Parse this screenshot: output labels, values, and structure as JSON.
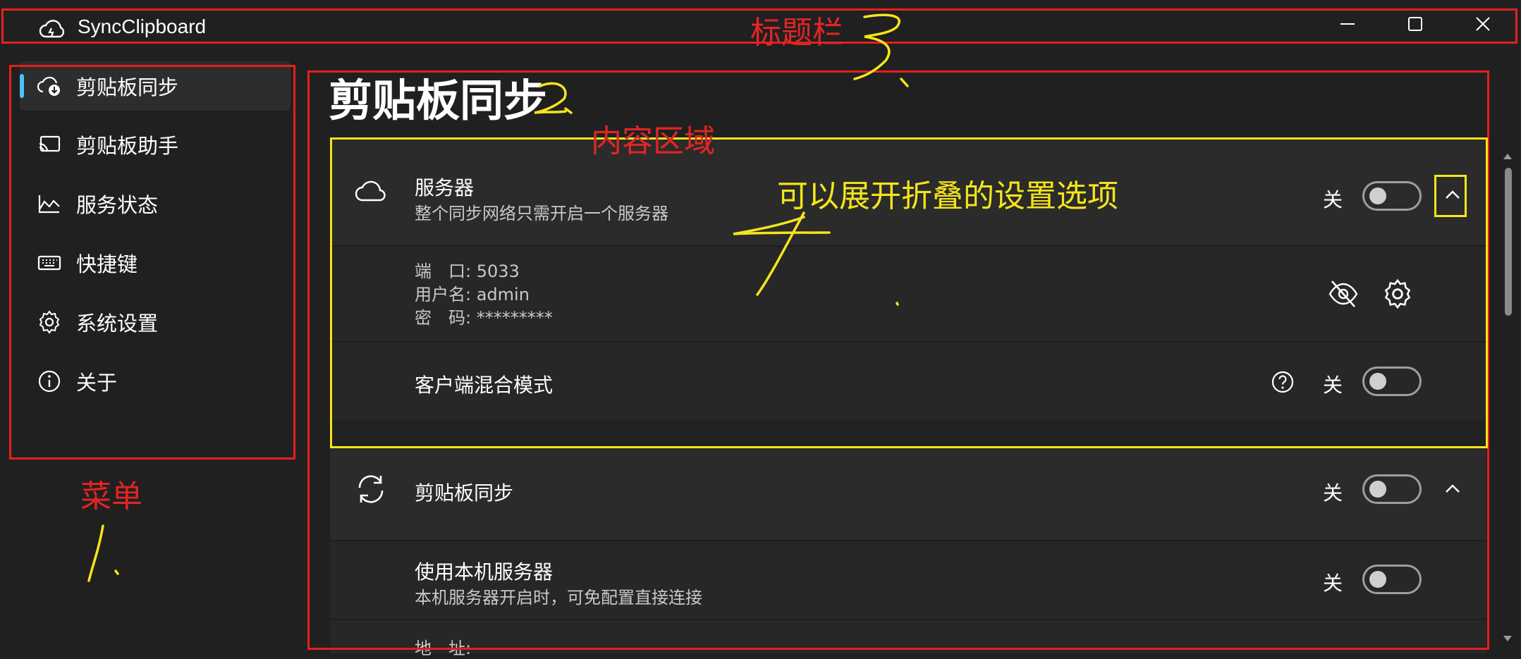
{
  "window": {
    "title": "SyncClipboard",
    "minimize_icon": "minimize-icon",
    "maximize_icon": "maximize-icon",
    "close_icon": "close-icon"
  },
  "sidebar": {
    "items": [
      {
        "label": "剪贴板同步",
        "icon": "cloud-sync-icon",
        "selected": true
      },
      {
        "label": "剪贴板助手",
        "icon": "cast-icon",
        "selected": false
      },
      {
        "label": "服务状态",
        "icon": "area-chart-icon",
        "selected": false
      },
      {
        "label": "快捷键",
        "icon": "keyboard-icon",
        "selected": false
      },
      {
        "label": "系统设置",
        "icon": "gear-icon",
        "selected": false
      },
      {
        "label": "关于",
        "icon": "info-icon",
        "selected": false
      }
    ]
  },
  "main": {
    "page_title": "剪贴板同步",
    "server_card": {
      "title": "服务器",
      "description": "整个同步网络只需开启一个服务器",
      "toggle_label": "关",
      "toggle_on": false
    },
    "server_info": {
      "port_line": "端　口: 5033",
      "user_line": "用户名: admin",
      "password_line": "密　码: *********"
    },
    "mixed_mode": {
      "title": "客户端混合模式",
      "toggle_label": "关",
      "toggle_on": false
    },
    "clipboard_sync_card": {
      "title": "剪贴板同步",
      "toggle_label": "关",
      "toggle_on": false
    },
    "local_server": {
      "title": "使用本机服务器",
      "description": "本机服务器开启时，可免配置直接连接",
      "toggle_label": "关",
      "toggle_on": false
    },
    "address_partial": "地　址:"
  },
  "annotations": {
    "titlebar_label": "标题栏",
    "content_label": "内容区域",
    "menu_label": "菜单",
    "expand_label": "可以展开折叠的设置选项",
    "num_1": "1",
    "num_2": "2",
    "num_3": "3",
    "num_4": "4",
    "red_color": "#e61e1e",
    "yellow_color": "#f5e51a"
  },
  "colors": {
    "background": "#202020",
    "card": "#2b2b2b",
    "accent": "#4cc2ff"
  }
}
